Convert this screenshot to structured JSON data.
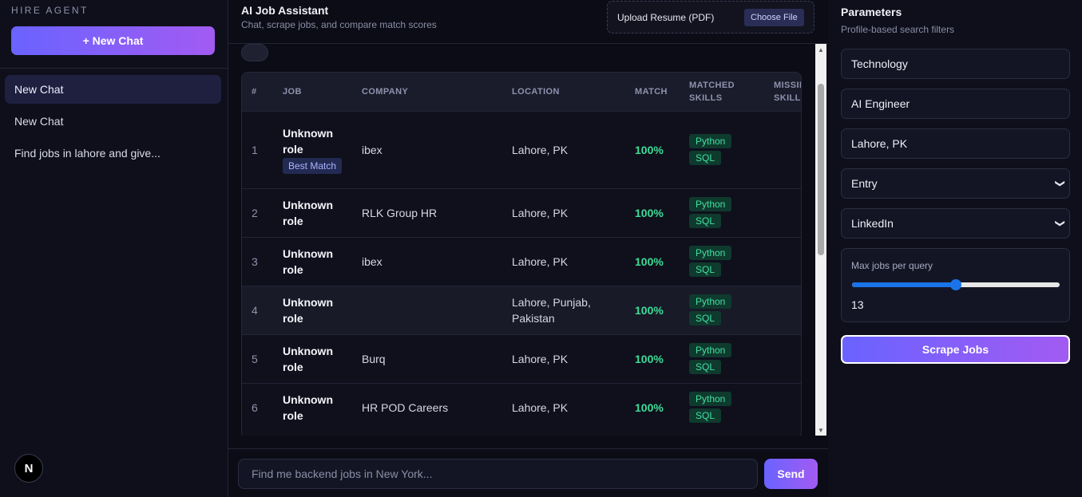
{
  "sidebar": {
    "brand": "HIRE AGENT",
    "new_chat_label": "+ New Chat",
    "items": [
      {
        "label": "New Chat"
      },
      {
        "label": "New Chat"
      },
      {
        "label": "Find jobs in lahore and give..."
      }
    ],
    "logo_letter": "N"
  },
  "header": {
    "title": "AI Job Assistant",
    "subtitle": "Chat, scrape jobs, and compare match scores",
    "upload_label": "Upload Resume (PDF)",
    "choose_file_label": "Choose File"
  },
  "table": {
    "columns": [
      "#",
      "JOB",
      "COMPANY",
      "LOCATION",
      "MATCH",
      "MATCHED SKILLS",
      "MISSING SKILLS"
    ],
    "rows": [
      {
        "num": "1",
        "job": "Unknown role",
        "badge": "Best Match",
        "company": "ibex",
        "location": "Lahore, PK",
        "match": "100%",
        "skills": [
          "Python",
          "SQL"
        ]
      },
      {
        "num": "2",
        "job": "Unknown role",
        "company": "RLK Group HR",
        "location": "Lahore, PK",
        "match": "100%",
        "skills": [
          "Python",
          "SQL"
        ]
      },
      {
        "num": "3",
        "job": "Unknown role",
        "company": "ibex",
        "location": "Lahore, PK",
        "match": "100%",
        "skills": [
          "Python",
          "SQL"
        ]
      },
      {
        "num": "4",
        "job": "Unknown role",
        "company": "",
        "location": "Lahore, Punjab, Pakistan",
        "match": "100%",
        "skills": [
          "Python",
          "SQL"
        ]
      },
      {
        "num": "5",
        "job": "Unknown role",
        "company": "Burq",
        "location": "Lahore, PK",
        "match": "100%",
        "skills": [
          "Python",
          "SQL"
        ]
      },
      {
        "num": "6",
        "job": "Unknown role",
        "company": "HR POD Careers",
        "location": "Lahore, PK",
        "match": "100%",
        "skills": [
          "Python",
          "SQL"
        ]
      }
    ]
  },
  "composer": {
    "placeholder": "Find me backend jobs in New York...",
    "send_label": "Send"
  },
  "params": {
    "title": "Parameters",
    "subtitle": "Profile-based search filters",
    "industry": "Technology",
    "role": "AI Engineer",
    "location": "Lahore, PK",
    "experience": "Entry",
    "source": "LinkedIn",
    "slider_label": "Max jobs per query",
    "max_jobs": "13",
    "max_jobs_fraction": 0.5,
    "scrape_label": "Scrape Jobs"
  },
  "colors": {
    "accent_start": "#6a63ff",
    "accent_end": "#a25bf2",
    "match_green": "#3ddc97",
    "skill_bg": "#0f3a2e"
  }
}
